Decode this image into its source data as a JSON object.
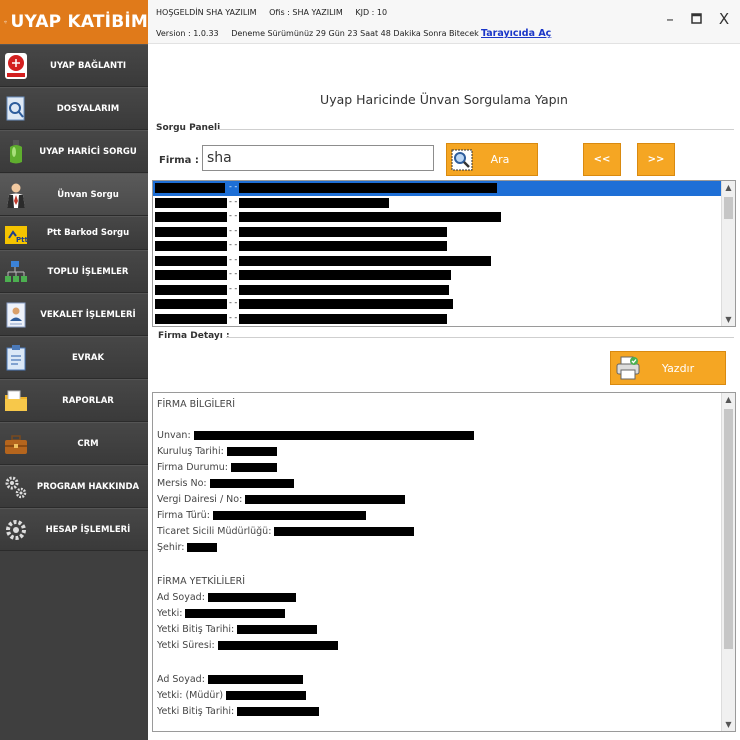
{
  "app": {
    "logo_text": "UYAP KATİBİM",
    "greeting": "HOŞGELDİN SHA YAZILIM",
    "office": "Ofis : SHA YAZILIM",
    "kid": "KJD : 10",
    "version": "Version : 1.0.33",
    "trial": "Deneme Sürümünüz 29 Gün 23 Saat 48 Dakika Sonra Bitecek",
    "browser_link": "Tarayıcıda Aç",
    "window_controls": {
      "minimize": "–",
      "maximize": "▪",
      "close": "X"
    }
  },
  "sidebar": {
    "items": [
      {
        "label": "UYAP BAĞLANTI",
        "icon": "uyap-logo-icon"
      },
      {
        "label": "DOSYALARIM",
        "icon": "folder-search-icon"
      },
      {
        "label": "UYAP HARİCİ SORGU",
        "icon": "green-bottle-icon"
      },
      {
        "label": "Ünvan Sorgu",
        "icon": "businessman-icon"
      },
      {
        "label": "Ptt Barkod Sorgu",
        "icon": "ptt-icon"
      },
      {
        "label": "TOPLU İŞLEMLER",
        "icon": "blocks-icon"
      },
      {
        "label": "VEKALET İŞLEMLERİ",
        "icon": "id-card-icon"
      },
      {
        "label": "EVRAK",
        "icon": "clipboard-icon"
      },
      {
        "label": "RAPORLAR",
        "icon": "folder-pen-icon"
      },
      {
        "label": "CRM",
        "icon": "briefcase-icon"
      },
      {
        "label": "PROGRAM HAKKINDA",
        "icon": "gears-icon"
      },
      {
        "label": "HESAP İŞLEMLERİ",
        "icon": "gear-icon"
      }
    ]
  },
  "main": {
    "title": "Uyap Haricinde Ünvan Sorgulama Yapın",
    "query_panel_label": "Sorgu Paneli",
    "firma_label": "Firma :",
    "firma_value": "sha",
    "search_label": "Ara",
    "prev_label": "<<",
    "next_label": ">>",
    "detail_label": "Firma Detayı :",
    "print_label": "Yazdır",
    "results_separator": "- -",
    "detail": {
      "company_section": "FİRMA BİLGİLERİ",
      "company_fields": [
        "Unvan:",
        "Kuruluş Tarihi:",
        "Firma Durumu:",
        "Mersis No:",
        "Vergi Dairesi / No:",
        "Firma Türü:",
        "Ticaret Sicili Müdürlüğü:",
        "Şehir:"
      ],
      "officers_section": "FİRMA YETKİLİLERİ",
      "officer1_fields": [
        "Ad Soyad:",
        "Yetki:",
        "Yetki Bitiş Tarihi:",
        "Yetki Süresi:"
      ],
      "officer2_fields": [
        "Ad Soyad:",
        "Yetki: (Müdür)",
        "Yetki Bitiş Tarihi:"
      ]
    }
  },
  "colors": {
    "accent": "#f5a623",
    "sidebar_bg": "#3f3f3f",
    "selected_row": "#1e6fd6",
    "link": "#1a36c8"
  }
}
